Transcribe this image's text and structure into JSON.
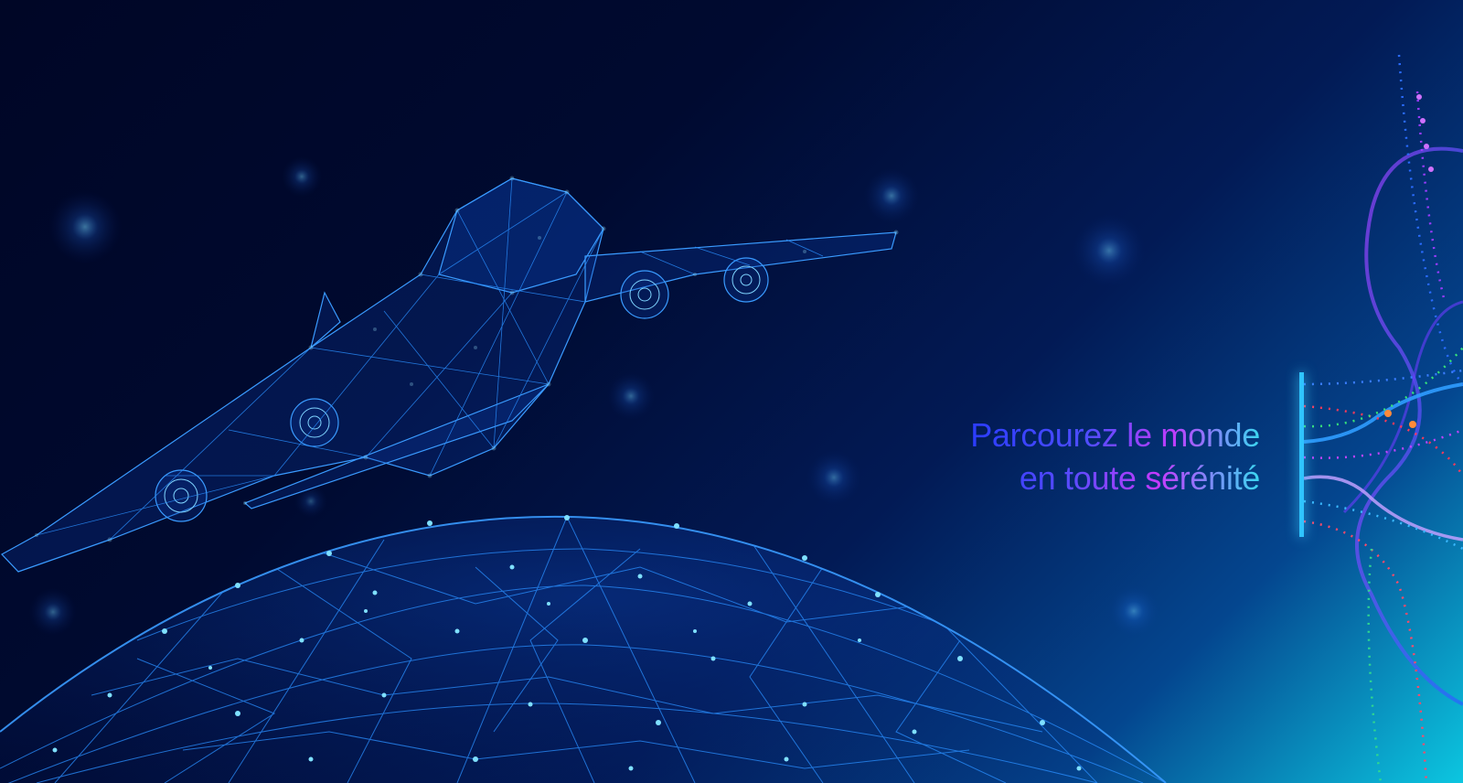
{
  "banner": {
    "headline_line1": "Parcourez le monde",
    "headline_line2": "en toute sérénité"
  },
  "colors": {
    "background_dark": "#000626",
    "background_light": "#0cc6e0",
    "wireframe": "#2a8fff",
    "glow": "#8fe8ff",
    "text_start": "#2b3cff",
    "text_mid": "#c03cff",
    "text_end": "#3ad8f0"
  },
  "illustration": {
    "main": "low-poly wireframe airplane",
    "secondary": "low-poly wireframe globe",
    "accent": "dotted flow lines"
  }
}
